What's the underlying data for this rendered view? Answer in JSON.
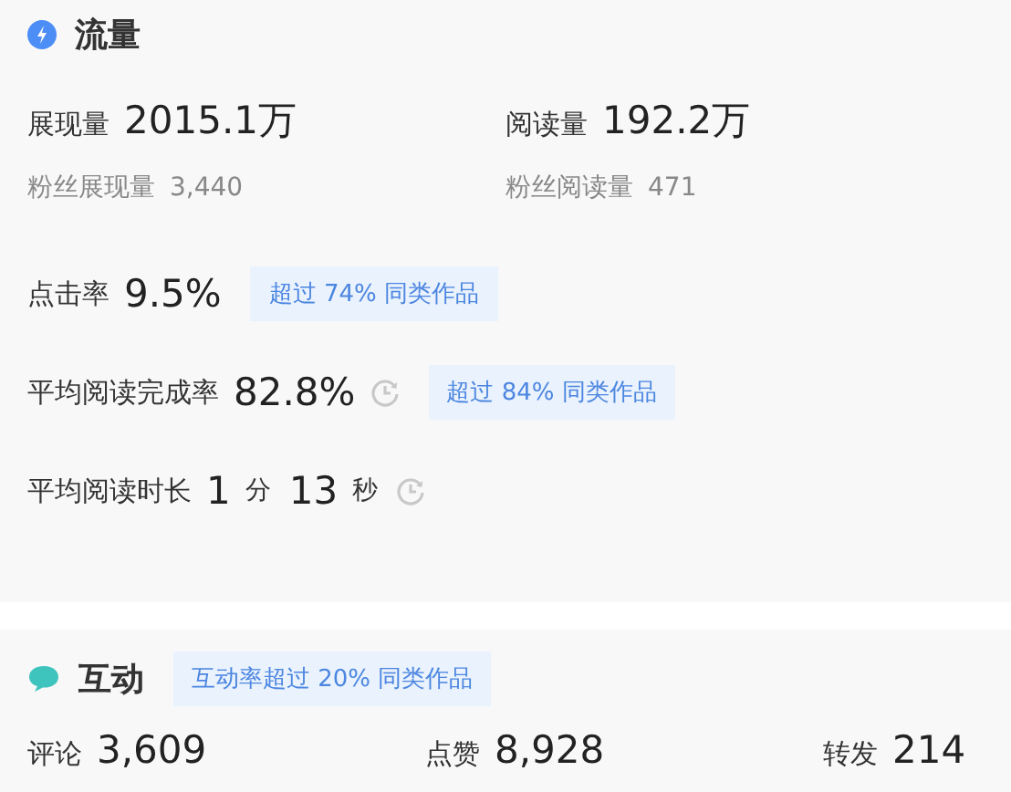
{
  "traffic": {
    "title": "流量",
    "totals": [
      {
        "label": "展现量",
        "value": "2015.1万",
        "fan_label": "粉丝展现量",
        "fan_value": "3,440"
      },
      {
        "label": "阅读量",
        "value": "192.2万",
        "fan_label": "粉丝阅读量",
        "fan_value": "471"
      }
    ],
    "metrics": [
      {
        "kind": "plain",
        "label": "点击率",
        "value": "9.5%",
        "timer": false,
        "badge": "超过 74% 同类作品"
      },
      {
        "kind": "plain",
        "label": "平均阅读完成率",
        "value": "82.8%",
        "timer": true,
        "badge": "超过 84% 同类作品"
      },
      {
        "kind": "duration",
        "label": "平均阅读时长",
        "parts": [
          {
            "value": "1",
            "unit": "分"
          },
          {
            "value": "13",
            "unit": "秒"
          }
        ],
        "timer": true
      }
    ]
  },
  "interaction": {
    "title": "互动",
    "badge": "互动率超过 20% 同类作品",
    "stats": [
      {
        "label": "评论",
        "value": "3,609"
      },
      {
        "label": "点赞",
        "value": "8,928"
      },
      {
        "label": "转发",
        "value": "214"
      }
    ]
  }
}
